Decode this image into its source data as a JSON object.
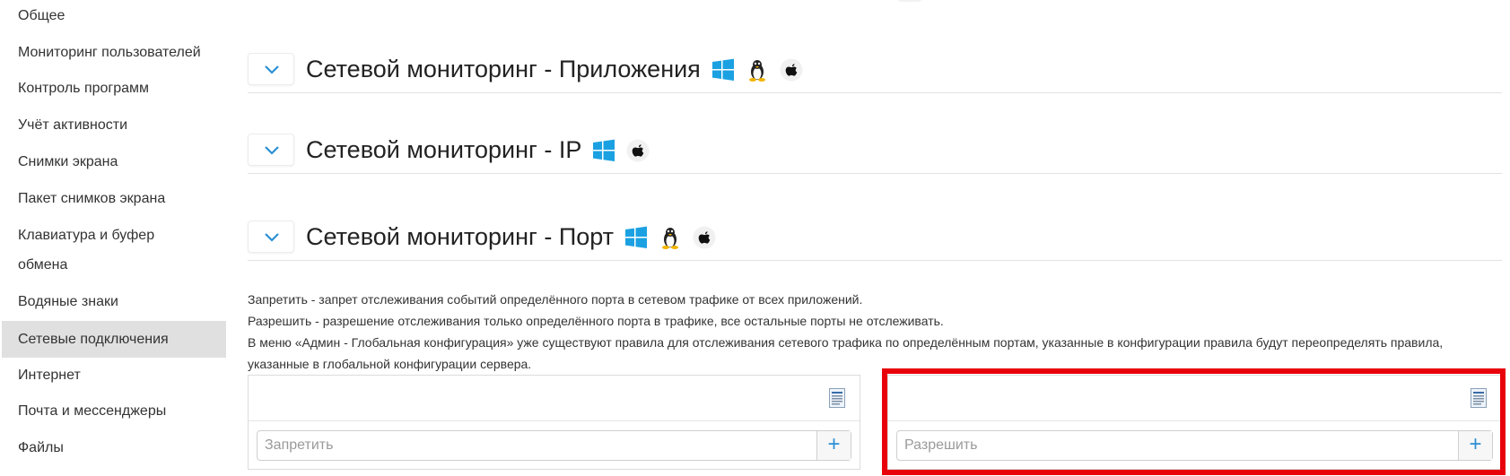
{
  "sidebar": {
    "items": [
      {
        "label": "Общее"
      },
      {
        "label": "Мониторинг пользователей"
      },
      {
        "label": "Контроль программ"
      },
      {
        "label": "Учёт активности"
      },
      {
        "label": "Снимки экрана"
      },
      {
        "label": "Пакет снимков экрана"
      },
      {
        "label": "Клавиатура и буфер",
        "label2": "обмена"
      },
      {
        "label": "Водяные знаки"
      },
      {
        "label": "Сетевые подключения",
        "active": true
      },
      {
        "label": "Интернет"
      },
      {
        "label": "Почта и мессенджеры"
      },
      {
        "label": "Файлы"
      }
    ]
  },
  "sections": [
    {
      "title": "Сетевой мониторинг - Приложения",
      "platforms": [
        "windows-icon",
        "linux-icon",
        "apple-icon"
      ]
    },
    {
      "title": "Сетевой мониторинг - IP",
      "platforms": [
        "windows-icon",
        "apple-icon"
      ]
    },
    {
      "title": "Сетевой мониторинг - Порт",
      "platforms": [
        "windows-icon",
        "linux-icon",
        "apple-icon"
      ]
    }
  ],
  "description": {
    "line1": "Запретить - запрет отслеживания событий определённого порта в сетевом трафике от всех приложений.",
    "line2": "Разрешить - разрешение отслеживания только определённого порта в трафике, все остальные порты не отслеживать.",
    "line3": "В меню «Админ - Глобальная конфигурация» уже существуют правила для отслеживания сетевого трафика по определённым портам, указанные в конфигурации правила будут переопределять правила,",
    "line4": "указанные в глобальной конфигурации сервера."
  },
  "deny_panel": {
    "placeholder": "Запретить",
    "value": "",
    "add_label": "+"
  },
  "allow_panel": {
    "placeholder": "Разрешить",
    "value": "",
    "add_label": "+"
  },
  "colors": {
    "highlight": "#e8000b",
    "accent": "#2a8fd4",
    "windows": "#1ba1e2",
    "active_bg": "#e0e0e0"
  }
}
